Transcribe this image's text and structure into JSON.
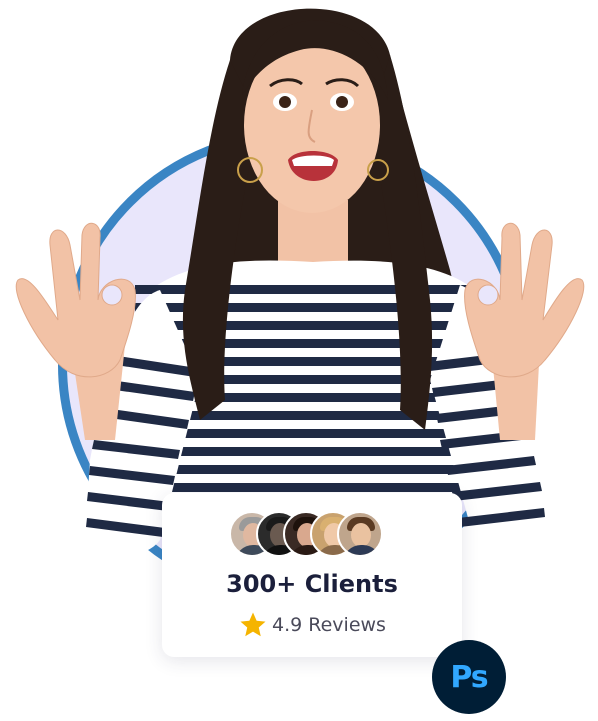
{
  "hero": {
    "image_alt": "Excited woman in striped shirt making OK hand signs"
  },
  "stats_card": {
    "clients_label": "300+ Clients",
    "rating_value": "4.9",
    "rating_label": "4.9 Reviews",
    "star_icon": "star-icon",
    "avatar_count": 5
  },
  "badge": {
    "label": "Ps",
    "icon": "photoshop-icon"
  },
  "colors": {
    "ring": "#3a85c4",
    "circle_fill": "#e9e6fb",
    "star": "#f5b400",
    "heading": "#1b1f3b",
    "ps_bg": "#001e36",
    "ps_fg": "#31a8ff"
  }
}
